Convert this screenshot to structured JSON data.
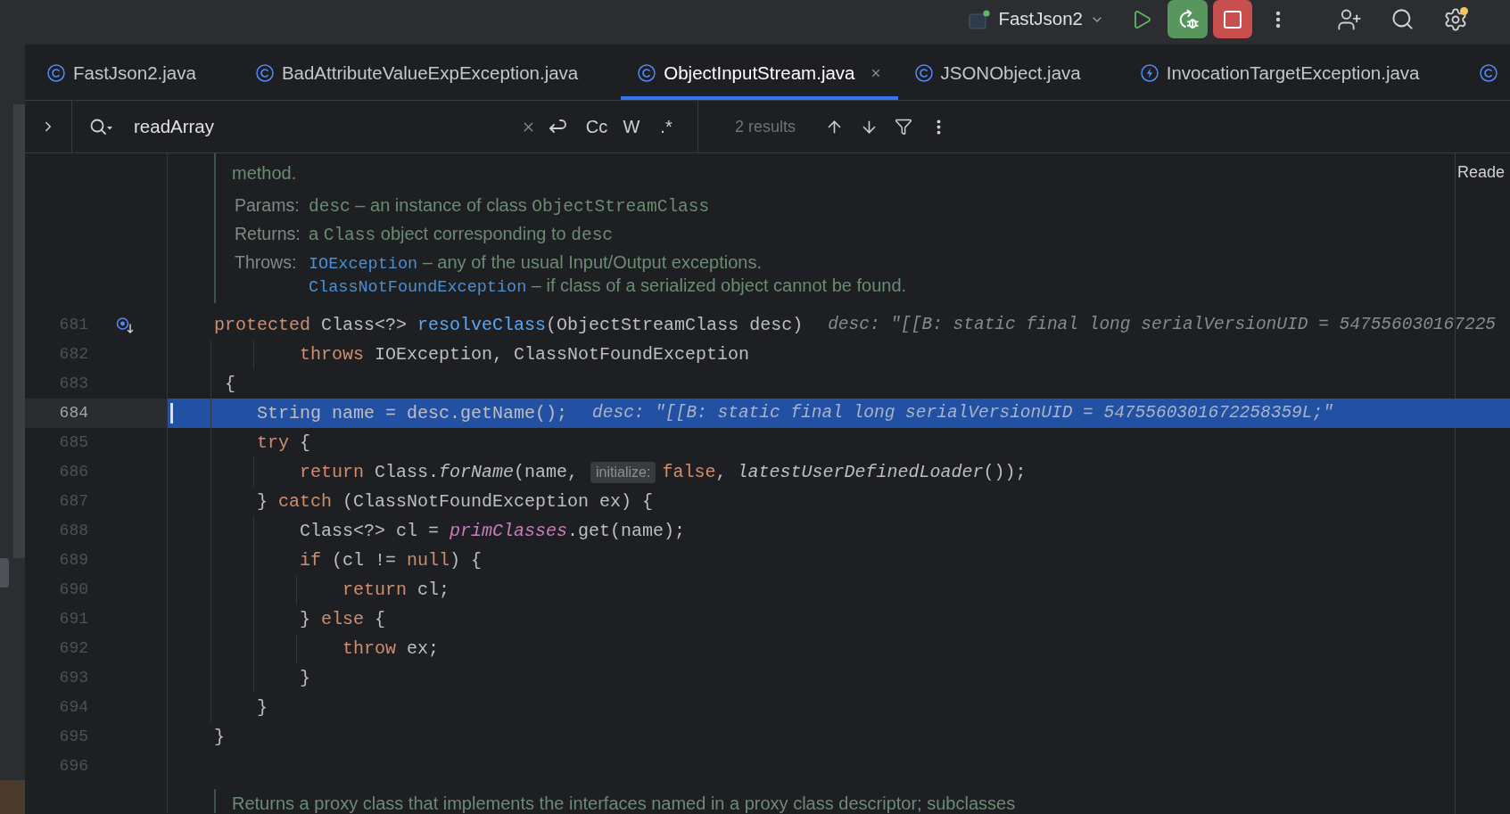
{
  "toolbar": {
    "project": "FastJson2"
  },
  "tabs": [
    {
      "label": "FastJson2.java",
      "kind": "class",
      "selected": false
    },
    {
      "label": "BadAttributeValueExpException.java",
      "kind": "class",
      "selected": false
    },
    {
      "label": "ObjectInputStream.java",
      "kind": "class",
      "selected": true
    },
    {
      "label": "JSONObject.java",
      "kind": "class",
      "selected": false
    },
    {
      "label": "InvocationTargetException.java",
      "kind": "exception",
      "selected": false
    },
    {
      "kind": "class",
      "selected": false
    }
  ],
  "find": {
    "value": "readArray",
    "match_case": "Cc",
    "words": "W",
    "regex": ".*",
    "results": "2 results"
  },
  "editor": {
    "reader_mode": "Reade",
    "doc_top": {
      "text": "method.",
      "sections": [
        {
          "label": "Params:",
          "lines": [
            {
              "parts": [
                {
                  "kind": "code",
                  "text": "desc"
                },
                {
                  "kind": "text",
                  "text": " – an instance of class "
                },
                {
                  "kind": "code",
                  "text": "ObjectStreamClass"
                }
              ]
            }
          ]
        },
        {
          "label": "Returns:",
          "lines": [
            {
              "parts": [
                {
                  "kind": "text",
                  "text": "a "
                },
                {
                  "kind": "code",
                  "text": "Class"
                },
                {
                  "kind": "text",
                  "text": " object corresponding to "
                },
                {
                  "kind": "code",
                  "text": "desc"
                }
              ]
            }
          ]
        },
        {
          "label": "Throws:",
          "lines": [
            {
              "parts": [
                {
                  "kind": "link",
                  "text": "IOException"
                },
                {
                  "kind": "text",
                  "text": " – any of the usual Input/Output exceptions."
                }
              ]
            },
            {
              "parts": [
                {
                  "kind": "link",
                  "text": "ClassNotFoundException"
                },
                {
                  "kind": "text",
                  "text": " – if class of a serialized object cannot be found."
                }
              ]
            }
          ]
        }
      ]
    },
    "lines": [
      {
        "number": "681",
        "marker": true,
        "current": false,
        "segments": [
          {
            "kind": "code",
            "tokens": [
              {
                "kind": "keyword",
                "text": "protected"
              },
              {
                "kind": "plain",
                "text": " Class<?> "
              },
              {
                "kind": "declaration",
                "text": "resolveClass"
              },
              {
                "kind": "plain",
                "text": "(ObjectStreamClass desc)"
              }
            ]
          },
          {
            "kind": "value_hint",
            "text": "desc: \"[[B: static final long serialVersionUID = 547556030167225"
          }
        ]
      },
      {
        "number": "682",
        "marker": false,
        "current": false,
        "segments": [
          {
            "kind": "code",
            "tokens": [
              {
                "kind": "keyword",
                "text": "        throws"
              },
              {
                "kind": "plain",
                "text": " IOException, ClassNotFoundException"
              }
            ]
          }
        ]
      },
      {
        "number": "683",
        "marker": false,
        "current": false,
        "segments": [
          {
            "kind": "code",
            "tokens": [
              {
                "kind": "plain",
                "text": " {"
              }
            ]
          }
        ]
      },
      {
        "number": "684",
        "marker": false,
        "current": true,
        "segments": [
          {
            "kind": "code",
            "tokens": [
              {
                "kind": "plain",
                "text": "    String name = desc.getName();"
              }
            ]
          },
          {
            "kind": "value_hint",
            "text": "desc: \"[[B: static final long serialVersionUID = 5475560301672258359L;\""
          }
        ]
      },
      {
        "number": "685",
        "marker": false,
        "current": false,
        "segments": [
          {
            "kind": "code",
            "tokens": [
              {
                "kind": "keyword",
                "text": "    try"
              },
              {
                "kind": "plain",
                "text": " {"
              }
            ]
          }
        ]
      },
      {
        "number": "686",
        "marker": false,
        "current": false,
        "segments": [
          {
            "kind": "code",
            "tokens": [
              {
                "kind": "keyword",
                "text": "        return"
              },
              {
                "kind": "plain",
                "text": " Class."
              },
              {
                "kind": "static_call",
                "text": "forName"
              },
              {
                "kind": "plain",
                "text": "(name,"
              }
            ]
          },
          {
            "kind": "param_hint",
            "text": "initialize:"
          },
          {
            "kind": "code",
            "tokens": [
              {
                "kind": "keyword",
                "text": "false"
              },
              {
                "kind": "plain",
                "text": ", "
              },
              {
                "kind": "static_call",
                "text": "latestUserDefinedLoader"
              },
              {
                "kind": "plain",
                "text": "());"
              }
            ]
          }
        ]
      },
      {
        "number": "687",
        "marker": false,
        "current": false,
        "segments": [
          {
            "kind": "code",
            "tokens": [
              {
                "kind": "plain",
                "text": "    } "
              },
              {
                "kind": "keyword",
                "text": "catch"
              },
              {
                "kind": "plain",
                "text": " (ClassNotFoundException ex) {"
              }
            ]
          }
        ]
      },
      {
        "number": "688",
        "marker": false,
        "current": false,
        "segments": [
          {
            "kind": "code",
            "tokens": [
              {
                "kind": "plain",
                "text": "        Class<?> cl = "
              },
              {
                "kind": "static_field",
                "text": "primClasses"
              },
              {
                "kind": "plain",
                "text": ".get(name);"
              }
            ]
          }
        ]
      },
      {
        "number": "689",
        "marker": false,
        "current": false,
        "segments": [
          {
            "kind": "code",
            "tokens": [
              {
                "kind": "keyword",
                "text": "        if"
              },
              {
                "kind": "plain",
                "text": " (cl != "
              },
              {
                "kind": "keyword",
                "text": "null"
              },
              {
                "kind": "plain",
                "text": ") {"
              }
            ]
          }
        ]
      },
      {
        "number": "690",
        "marker": false,
        "current": false,
        "segments": [
          {
            "kind": "code",
            "tokens": [
              {
                "kind": "keyword",
                "text": "            return"
              },
              {
                "kind": "plain",
                "text": " cl;"
              }
            ]
          }
        ]
      },
      {
        "number": "691",
        "marker": false,
        "current": false,
        "segments": [
          {
            "kind": "code",
            "tokens": [
              {
                "kind": "plain",
                "text": "        } "
              },
              {
                "kind": "keyword",
                "text": "else"
              },
              {
                "kind": "plain",
                "text": " {"
              }
            ]
          }
        ]
      },
      {
        "number": "692",
        "marker": false,
        "current": false,
        "segments": [
          {
            "kind": "code",
            "tokens": [
              {
                "kind": "keyword",
                "text": "            throw"
              },
              {
                "kind": "plain",
                "text": " ex;"
              }
            ]
          }
        ]
      },
      {
        "number": "693",
        "marker": false,
        "current": false,
        "segments": [
          {
            "kind": "code",
            "tokens": [
              {
                "kind": "plain",
                "text": "        }"
              }
            ]
          }
        ]
      },
      {
        "number": "694",
        "marker": false,
        "current": false,
        "segments": [
          {
            "kind": "code",
            "tokens": [
              {
                "kind": "plain",
                "text": "    }"
              }
            ]
          }
        ]
      },
      {
        "number": "695",
        "marker": false,
        "current": false,
        "segments": [
          {
            "kind": "code",
            "tokens": [
              {
                "kind": "plain",
                "text": "}"
              }
            ]
          }
        ]
      },
      {
        "number": "696",
        "marker": false,
        "current": false
      }
    ],
    "doc_bottom": "Returns a proxy class that implements the interfaces named in a proxy class descriptor; subclasses"
  }
}
